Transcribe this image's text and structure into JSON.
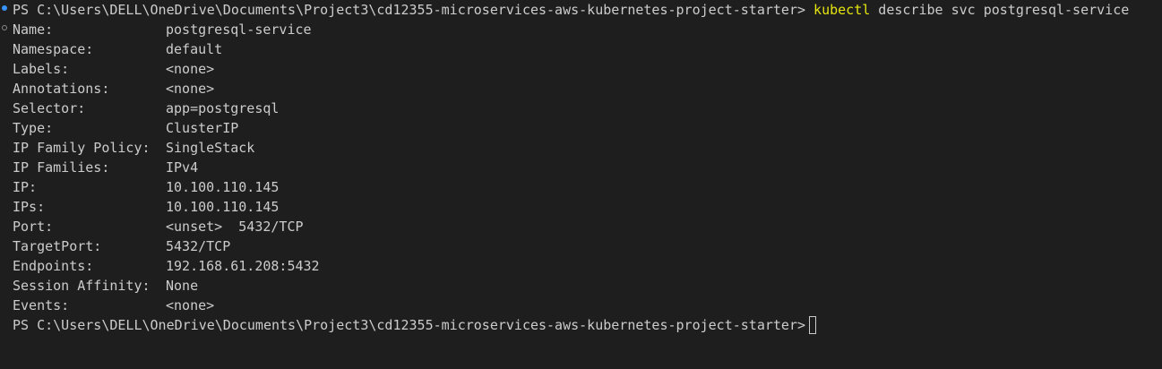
{
  "terminal": {
    "prompt": "PS C:\\Users\\DELL\\OneDrive\\Documents\\Project3\\cd12355-microservices-aws-kubernetes-project-starter>",
    "command": {
      "name": "kubectl",
      "args": "describe svc postgresql-service"
    },
    "fields": [
      {
        "label": "Name:",
        "value": "postgresql-service"
      },
      {
        "label": "Namespace:",
        "value": "default"
      },
      {
        "label": "Labels:",
        "value": "<none>"
      },
      {
        "label": "Annotations:",
        "value": "<none>"
      },
      {
        "label": "Selector:",
        "value": "app=postgresql"
      },
      {
        "label": "Type:",
        "value": "ClusterIP"
      },
      {
        "label": "IP Family Policy:",
        "value": "SingleStack"
      },
      {
        "label": "IP Families:",
        "value": "IPv4"
      },
      {
        "label": "IP:",
        "value": "10.100.110.145"
      },
      {
        "label": "IPs:",
        "value": "10.100.110.145"
      },
      {
        "label": "Port:",
        "value": "<unset>  5432/TCP"
      },
      {
        "label": "TargetPort:",
        "value": "5432/TCP"
      },
      {
        "label": "Endpoints:",
        "value": "192.168.61.208:5432"
      },
      {
        "label": "Session Affinity:",
        "value": "None"
      },
      {
        "label": "Events:",
        "value": "<none>"
      }
    ],
    "final_prompt": "PS C:\\Users\\DELL\\OneDrive\\Documents\\Project3\\cd12355-microservices-aws-kubernetes-project-starter>",
    "colors": {
      "background": "#1e1e1e",
      "text": "#cccccc",
      "command_highlight": "#e5e510",
      "decoration_success": "#3794ff"
    }
  }
}
